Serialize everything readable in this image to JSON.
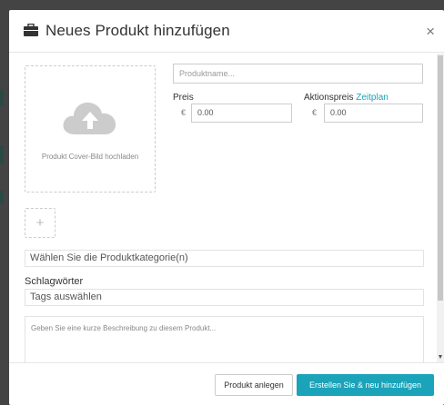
{
  "modal": {
    "title": "Neues Produkt hinzufügen",
    "header_icon": "briefcase-icon",
    "close_label": "×"
  },
  "cover": {
    "icon": "cloud-upload-icon",
    "label": "Produkt Cover-Bild hochladen"
  },
  "product_name": {
    "placeholder": "Produktname..."
  },
  "price": {
    "label": "Preis",
    "currency": "€",
    "value": "0.00"
  },
  "sale_price": {
    "label": "Aktionspreis",
    "schedule_link": "Zeitplan",
    "currency": "€",
    "value": "0.00"
  },
  "add_image": {
    "icon": "plus-icon",
    "symbol": "+"
  },
  "category": {
    "placeholder": "Wählen Sie die Produktkategorie(n)"
  },
  "tags": {
    "label": "Schlagwörter",
    "placeholder": "Tags auswählen"
  },
  "description": {
    "placeholder": "Geben Sie eine kurze Beschreibung zu diesem Produkt..."
  },
  "footer": {
    "create_label": "Produkt anlegen",
    "create_new_label": "Erstellen Sie & neu hinzufügen"
  },
  "colors": {
    "accent": "#1aa3b9",
    "backdrop": "#444444"
  }
}
